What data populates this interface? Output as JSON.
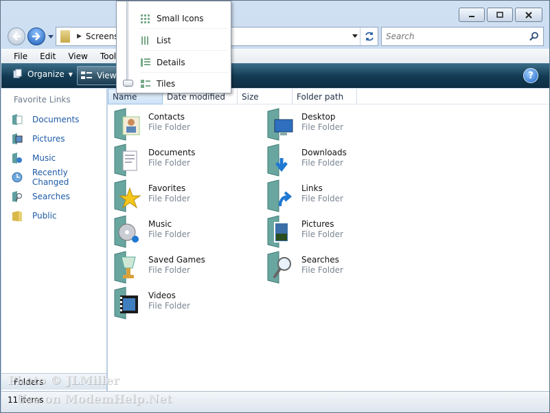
{
  "window": {
    "address_path": "Screensh"
  },
  "search": {
    "placeholder": "Search"
  },
  "menubar": {
    "items": [
      "File",
      "Edit",
      "View",
      "Tools"
    ]
  },
  "commandbar": {
    "organize_label": "Organize",
    "views_label": "Views",
    "help_label": "?"
  },
  "views_menu": {
    "items": [
      "Small Icons",
      "List",
      "Details",
      "Tiles"
    ],
    "selected": "Tiles"
  },
  "navpane": {
    "title": "Favorite Links",
    "items": [
      "Documents",
      "Pictures",
      "Music",
      "Recently Changed",
      "Searches",
      "Public"
    ],
    "folders_label": "Folders"
  },
  "columns": [
    "Name",
    "Date modified",
    "Size",
    "Folder path"
  ],
  "files": [
    {
      "name": "Contacts",
      "type": "File Folder",
      "icon": "contacts-folder-icon"
    },
    {
      "name": "Desktop",
      "type": "File Folder",
      "icon": "desktop-folder-icon"
    },
    {
      "name": "Documents",
      "type": "File Folder",
      "icon": "documents-folder-icon"
    },
    {
      "name": "Downloads",
      "type": "File Folder",
      "icon": "downloads-folder-icon"
    },
    {
      "name": "Favorites",
      "type": "File Folder",
      "icon": "favorites-folder-icon"
    },
    {
      "name": "Links",
      "type": "File Folder",
      "icon": "links-folder-icon"
    },
    {
      "name": "Music",
      "type": "File Folder",
      "icon": "music-folder-icon"
    },
    {
      "name": "Pictures",
      "type": "File Folder",
      "icon": "pictures-folder-icon"
    },
    {
      "name": "Saved Games",
      "type": "File Folder",
      "icon": "saved-games-folder-icon"
    },
    {
      "name": "Searches",
      "type": "File Folder",
      "icon": "searches-folder-icon"
    },
    {
      "name": "Videos",
      "type": "File Folder",
      "icon": "videos-folder-icon"
    }
  ],
  "statusbar": {
    "text": "11 items"
  },
  "watermark": {
    "line1": "Photo © JLMiller",
    "line2": "Use on ModemHelp.Net"
  }
}
